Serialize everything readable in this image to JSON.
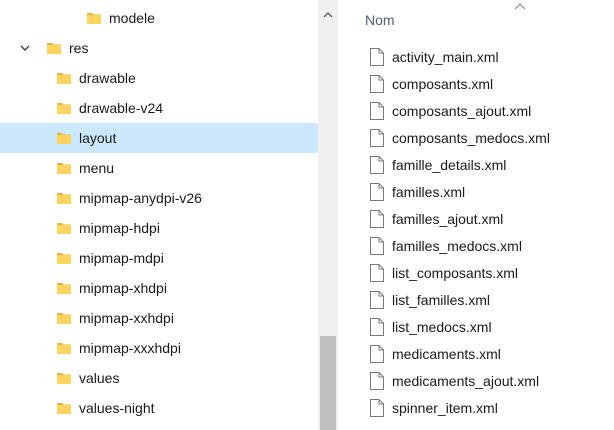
{
  "tree": {
    "items": [
      {
        "label": "modele",
        "selected": false,
        "expandable": false,
        "expanded": false
      },
      {
        "label": "res",
        "selected": false,
        "expandable": true,
        "expanded": true
      },
      {
        "label": "drawable",
        "selected": false,
        "expandable": false,
        "expanded": false
      },
      {
        "label": "drawable-v24",
        "selected": false,
        "expandable": false,
        "expanded": false
      },
      {
        "label": "layout",
        "selected": true,
        "expandable": false,
        "expanded": false
      },
      {
        "label": "menu",
        "selected": false,
        "expandable": false,
        "expanded": false
      },
      {
        "label": "mipmap-anydpi-v26",
        "selected": false,
        "expandable": false,
        "expanded": false
      },
      {
        "label": "mipmap-hdpi",
        "selected": false,
        "expandable": false,
        "expanded": false
      },
      {
        "label": "mipmap-mdpi",
        "selected": false,
        "expandable": false,
        "expanded": false
      },
      {
        "label": "mipmap-xhdpi",
        "selected": false,
        "expandable": false,
        "expanded": false
      },
      {
        "label": "mipmap-xxhdpi",
        "selected": false,
        "expandable": false,
        "expanded": false
      },
      {
        "label": "mipmap-xxxhdpi",
        "selected": false,
        "expandable": false,
        "expanded": false
      },
      {
        "label": "values",
        "selected": false,
        "expandable": false,
        "expanded": false
      },
      {
        "label": "values-night",
        "selected": false,
        "expandable": false,
        "expanded": false
      }
    ]
  },
  "list": {
    "column_header": "Nom",
    "files": [
      "activity_main.xml",
      "composants.xml",
      "composants_ajout.xml",
      "composants_medocs.xml",
      "famille_details.xml",
      "familles.xml",
      "familles_ajout.xml",
      "familles_medocs.xml",
      "list_composants.xml",
      "list_familles.xml",
      "list_medocs.xml",
      "medicaments.xml",
      "medicaments_ajout.xml",
      "spinner_item.xml"
    ]
  },
  "icons": {
    "folder": "folder-icon",
    "file": "file-icon",
    "expand": "chevron-down-icon",
    "scroll_up": "arrow-up-icon",
    "sort": "sort-ascending-icon"
  },
  "colors": {
    "selection": "#cce8ff",
    "folder": "#ffd45e",
    "folder_dark": "#e8b33a",
    "header_text": "#4c607a",
    "scrollbar_track": "#f0f0f0",
    "scrollbar_thumb": "#c1c1c1"
  }
}
